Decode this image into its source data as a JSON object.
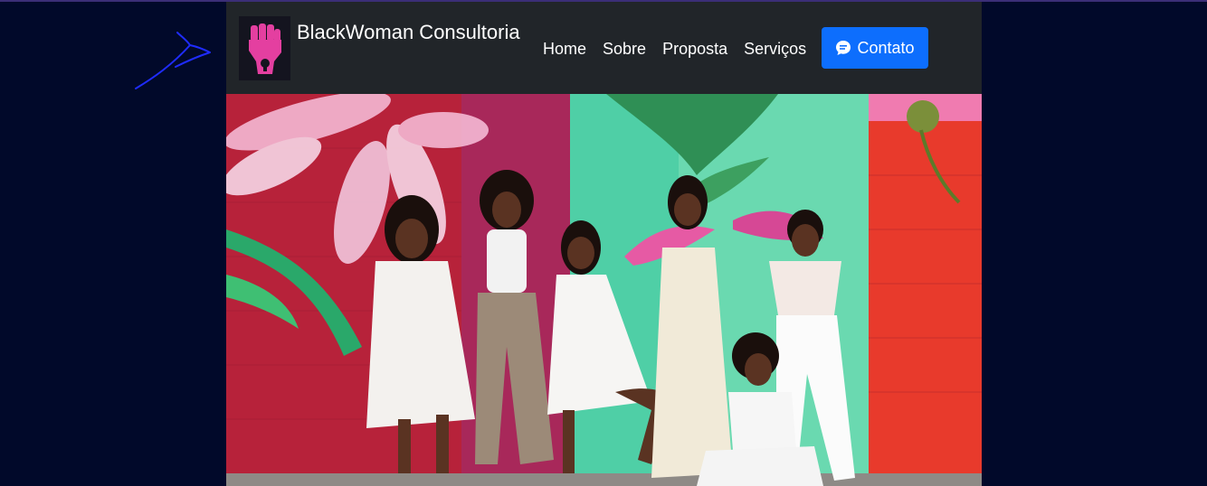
{
  "navbar": {
    "brand": "BlackWoman Consultoria",
    "links": [
      "Home",
      "Sobre",
      "Proposta",
      "Serviços"
    ],
    "contact_label": "Contato"
  },
  "icons": {
    "logo": "raised-fist-icon",
    "contact": "chat-bubble-icon",
    "annotation": "arrow-scribble-icon"
  },
  "colors": {
    "page_background": "#01092a",
    "navbar_background": "#212529",
    "contact_button": "#0d6efd",
    "logo_fist": "#e43fa0"
  }
}
